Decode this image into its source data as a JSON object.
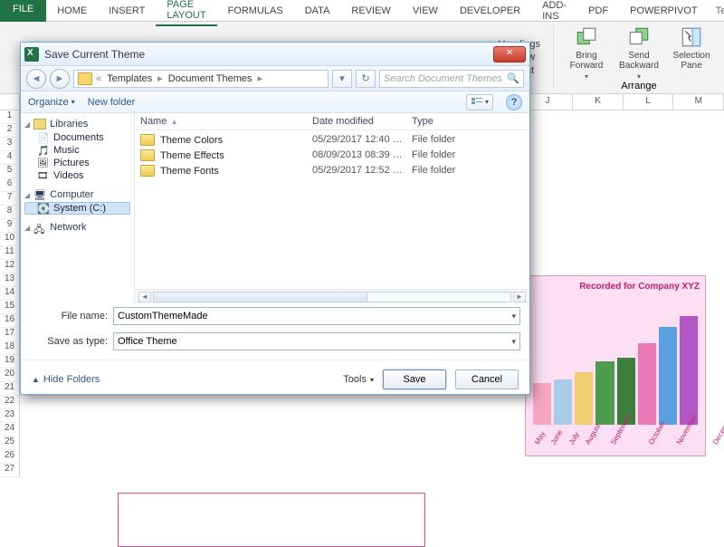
{
  "ribbon_tabs": {
    "file": "FILE",
    "items": [
      "HOME",
      "INSERT",
      "PAGE LAYOUT",
      "FORMULAS",
      "DATA",
      "REVIEW",
      "VIEW",
      "DEVELOPER",
      "ADD-INS",
      "PDF",
      "POWERPIVOT"
    ],
    "active": "PAGE LAYOUT",
    "right": "Team"
  },
  "ribbon": {
    "opt_headings": "Headings",
    "opt_view": "View",
    "opt_print": "Print",
    "bring_forward": "Bring Forward",
    "send_backward": "Send Backward",
    "selection_pane": "Selection Pane",
    "arrange_label": "Arrange"
  },
  "columns": [
    "J",
    "K",
    "L",
    "M"
  ],
  "dialog": {
    "title": "Save Current Theme",
    "breadcrumbs": [
      "Templates",
      "Document Themes"
    ],
    "search_placeholder": "Search Document Themes",
    "toolbar": {
      "organize": "Organize",
      "newfolder": "New folder"
    },
    "headers": {
      "name": "Name",
      "date": "Date modified",
      "type": "Type"
    },
    "files": [
      {
        "name": "Theme Colors",
        "date": "05/29/2017 12:40 …",
        "type": "File folder"
      },
      {
        "name": "Theme Effects",
        "date": "08/09/2013 08:39 …",
        "type": "File folder"
      },
      {
        "name": "Theme Fonts",
        "date": "05/29/2017 12:52 …",
        "type": "File folder"
      }
    ],
    "nav": {
      "libraries": "Libraries",
      "documents": "Documents",
      "music": "Music",
      "pictures": "Pictures",
      "videos": "Videos",
      "computer": "Computer",
      "system": "System (C:)",
      "network": "Network"
    },
    "filename_label": "File name:",
    "filename_value": "CustomThemeMade",
    "saveas_label": "Save as type:",
    "saveas_value": "Office Theme",
    "hide_folders": "Hide Folders",
    "tools": "Tools",
    "save": "Save",
    "cancel": "Cancel"
  },
  "chart_data": {
    "type": "bar",
    "title": "Recorded for Company XYZ",
    "categories": [
      "May",
      "June",
      "July",
      "August",
      "September",
      "October",
      "November",
      "December"
    ],
    "values": [
      38,
      42,
      48,
      58,
      62,
      75,
      90,
      100
    ],
    "colors": [
      "#f7a6c1",
      "#a8cce8",
      "#f0d071",
      "#4e9d4e",
      "#3c7f3c",
      "#e879b6",
      "#5aa0e0",
      "#b356c8"
    ],
    "ylim": [
      0,
      100
    ]
  }
}
